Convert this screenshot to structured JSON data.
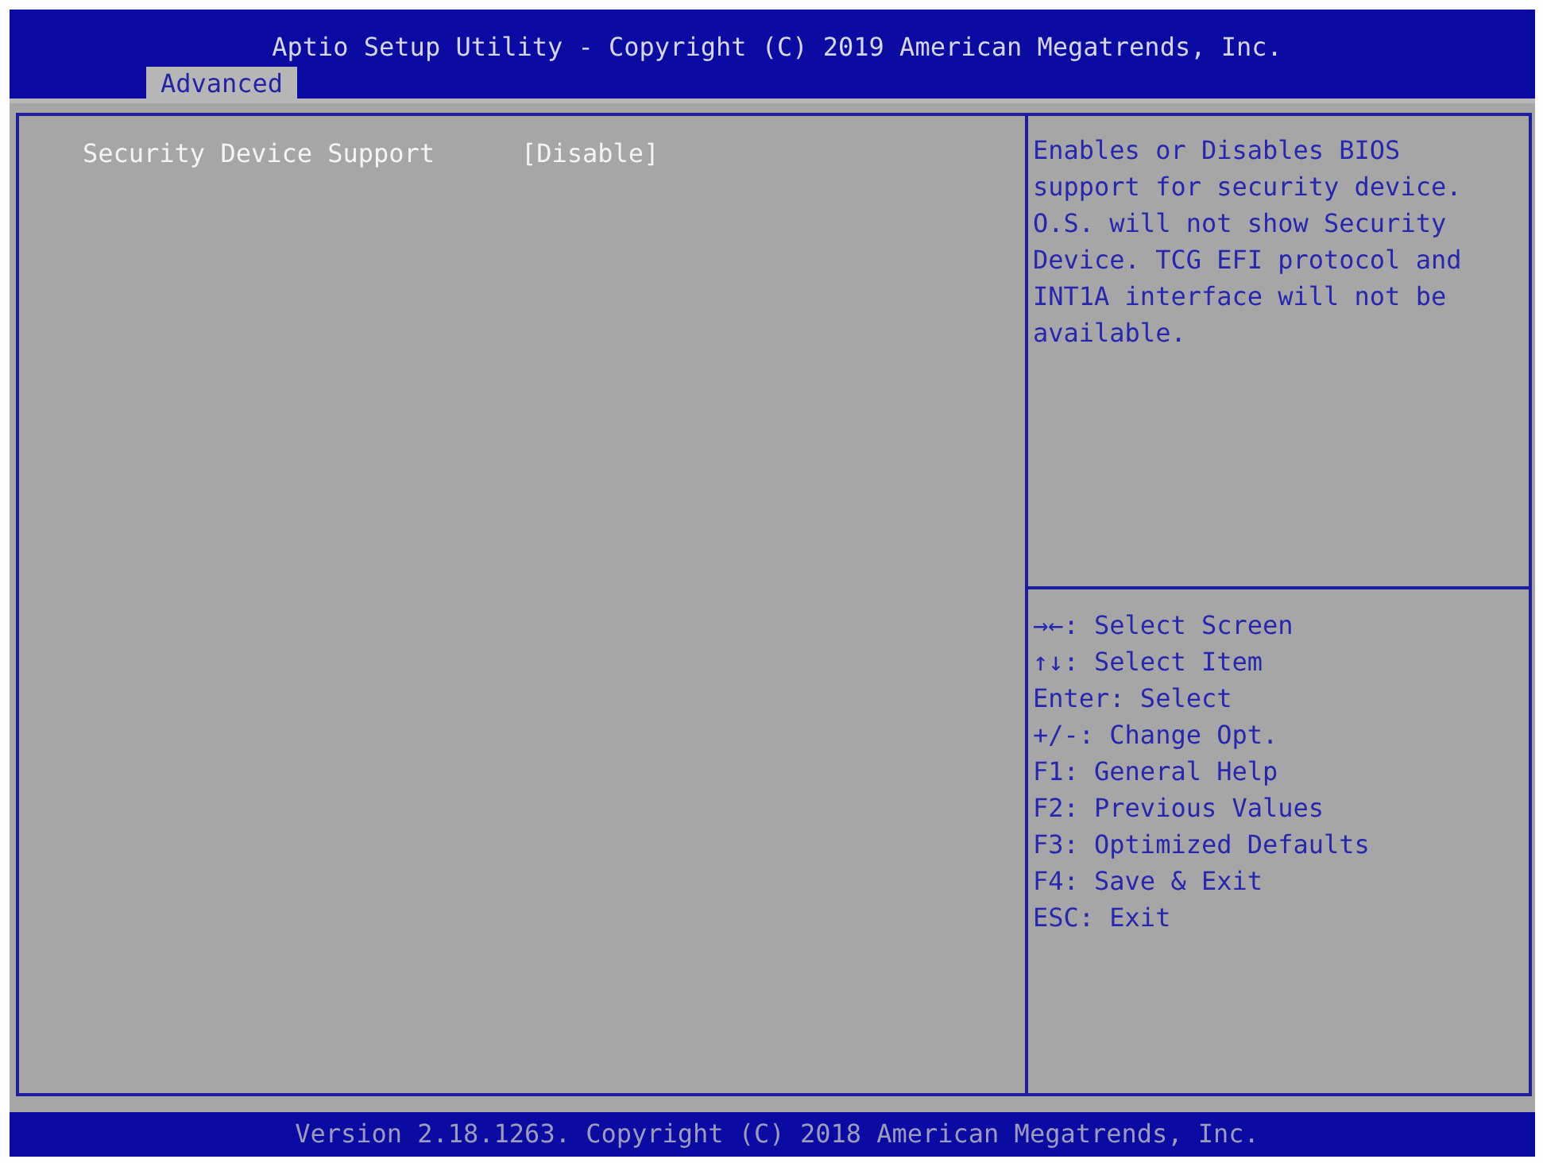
{
  "window": {
    "title": "Aptio Setup Utility - Copyright (C) 2019 American Megatrends, Inc."
  },
  "tabs": [
    {
      "label": "Advanced",
      "selected": true
    }
  ],
  "settings": [
    {
      "label": "Security Device Support",
      "value": "[Disable]",
      "selected": true
    }
  ],
  "help": {
    "description": "Enables or Disables BIOS support for security device. O.S. will not show Security Device. TCG EFI protocol and INT1A interface will not be available.",
    "keys": [
      "→←: Select Screen",
      "↑↓: Select Item",
      "Enter: Select",
      "+/-: Change Opt.",
      "F1: General Help",
      "F2: Previous Values",
      "F3: Optimized Defaults",
      "F4: Save & Exit",
      "ESC: Exit"
    ]
  },
  "status_bar": {
    "text": "Version 2.18.1263. Copyright (C) 2018 American Megatrends, Inc."
  }
}
